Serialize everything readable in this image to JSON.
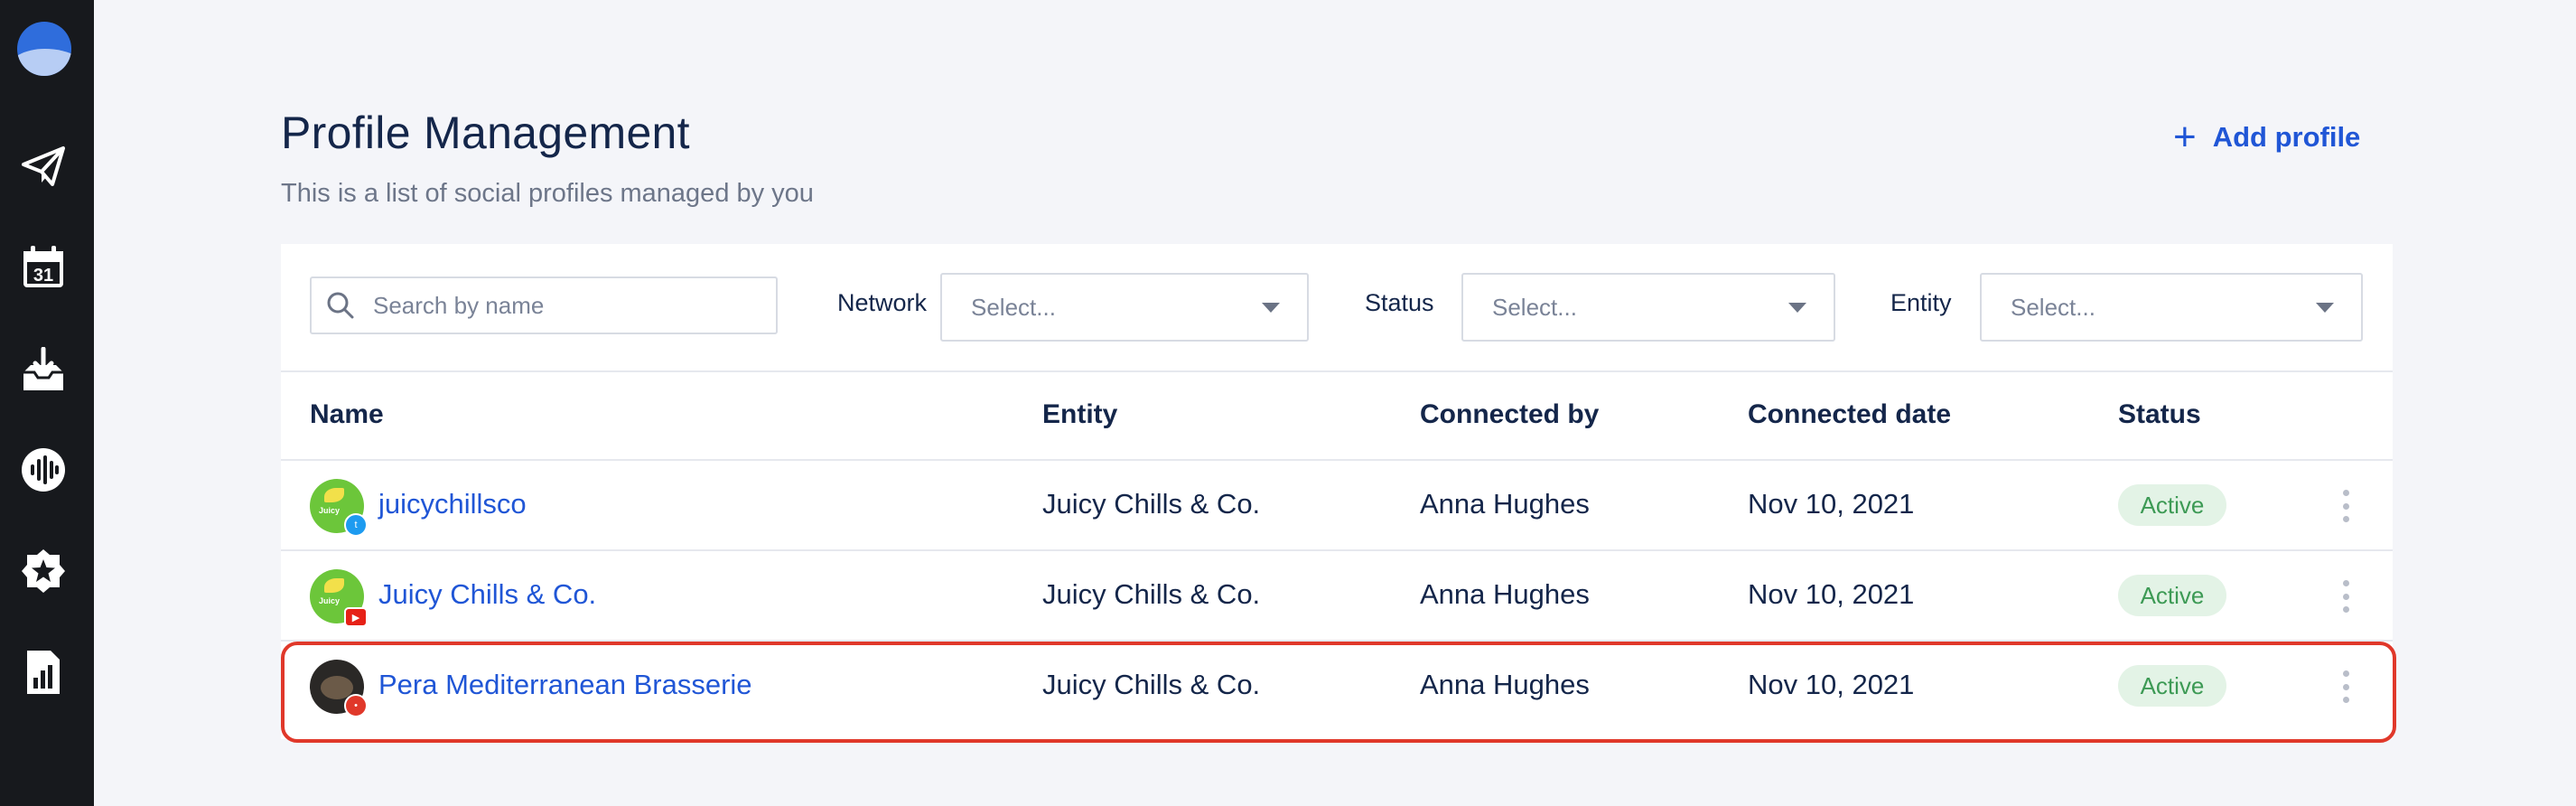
{
  "colors": {
    "sidebar": "#17191d",
    "accent": "#2056d6",
    "highlight": "#e0382a",
    "active_bg": "#e3f3e6",
    "active_text": "#3d9a55"
  },
  "sidebar": {
    "items": [
      {
        "icon": "paper-plane-icon"
      },
      {
        "icon": "calendar-icon",
        "text": "31"
      },
      {
        "icon": "inbox-icon"
      },
      {
        "icon": "listening-icon"
      },
      {
        "icon": "star-icon"
      },
      {
        "icon": "reports-icon"
      }
    ]
  },
  "header": {
    "title": "Profile Management",
    "subtitle": "This is a list of social profiles managed by you",
    "add_button": "Add profile"
  },
  "filters": {
    "search_placeholder": "Search by name",
    "network_label": "Network",
    "network_value": "Select...",
    "status_label": "Status",
    "status_value": "Select...",
    "entity_label": "Entity",
    "entity_value": "Select..."
  },
  "table": {
    "columns": [
      "Name",
      "Entity",
      "Connected by",
      "Connected date",
      "Status"
    ],
    "rows": [
      {
        "name": "juicychillsco",
        "network": "twitter",
        "entity": "Juicy Chills & Co.",
        "connected_by": "Anna Hughes",
        "date": "Nov 10, 2021",
        "status": "Active"
      },
      {
        "name": "Juicy Chills & Co.",
        "network": "youtube",
        "entity": "Juicy Chills & Co.",
        "connected_by": "Anna Hughes",
        "date": "Nov 10, 2021",
        "status": "Active"
      },
      {
        "name": "Pera Mediterranean Brasserie",
        "network": "google",
        "entity": "Juicy Chills & Co.",
        "connected_by": "Anna Hughes",
        "date": "Nov 10, 2021",
        "status": "Active"
      }
    ]
  }
}
